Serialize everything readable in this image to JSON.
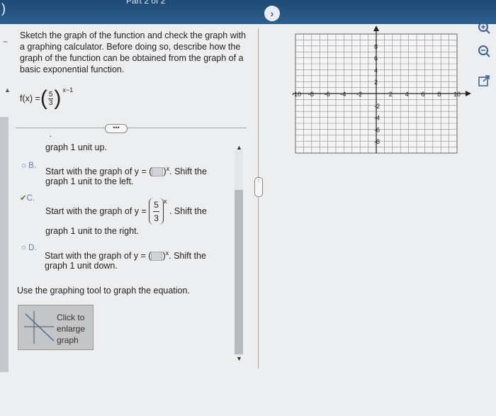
{
  "header": {
    "part_label": "Part 2 of 2"
  },
  "question": {
    "prompt": "Sketch the graph of the function and check the graph with a graphing calculator. Before doing so, describe how the graph of the function can be obtained from the graph of a basic exponential function.",
    "function_prefix": "f(x) =",
    "fraction_num": "5",
    "fraction_den": "3",
    "exponent": "x−1"
  },
  "options": {
    "a_tail": "graph 1 unit up.",
    "b": {
      "label": "B.",
      "pre": "Start with the graph of y =",
      "post": "Shift the",
      "line2": "graph 1 unit to the left."
    },
    "c": {
      "label": "C.",
      "pre": "Start with the graph of y =",
      "num": "5",
      "den": "3",
      "exp": "x",
      "post": "Shift the",
      "line2": "graph 1 unit to the right."
    },
    "d": {
      "label": "D.",
      "pre": "Start with the graph of y =",
      "post": "Shift the",
      "line2": "graph 1 unit down."
    },
    "superscript_x": "x"
  },
  "instructions": "Use the graphing tool to graph the equation.",
  "graph_button": {
    "line1": "Click to",
    "line2": "enlarge",
    "line3": "graph"
  },
  "graph": {
    "x_ticks": [
      "-10",
      "-8",
      "-6",
      "-4",
      "-2",
      "2",
      "4",
      "6",
      "8",
      "10"
    ],
    "y_ticks": [
      "8",
      "6",
      "4",
      "2",
      "-2",
      "-4",
      "-6",
      "-8"
    ]
  },
  "icons": [
    "zoom-in-icon",
    "zoom-out-icon",
    "external-link-icon"
  ]
}
